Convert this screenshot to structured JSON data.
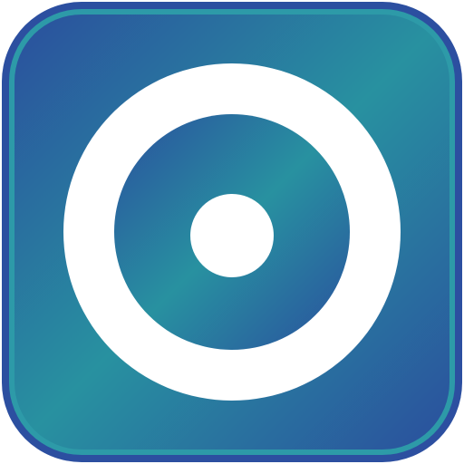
{
  "icon": {
    "name": "disc-icon",
    "colors": {
      "border": "#2c4fa0",
      "inner_rim": "#2d9aa8",
      "gradient_start": "#2a4f9e",
      "gradient_mid": "#2891a0",
      "gradient_end": "#2a4f9e",
      "ring": "#ffffff",
      "center_dot": "#ffffff",
      "background": "#ffffff"
    }
  }
}
